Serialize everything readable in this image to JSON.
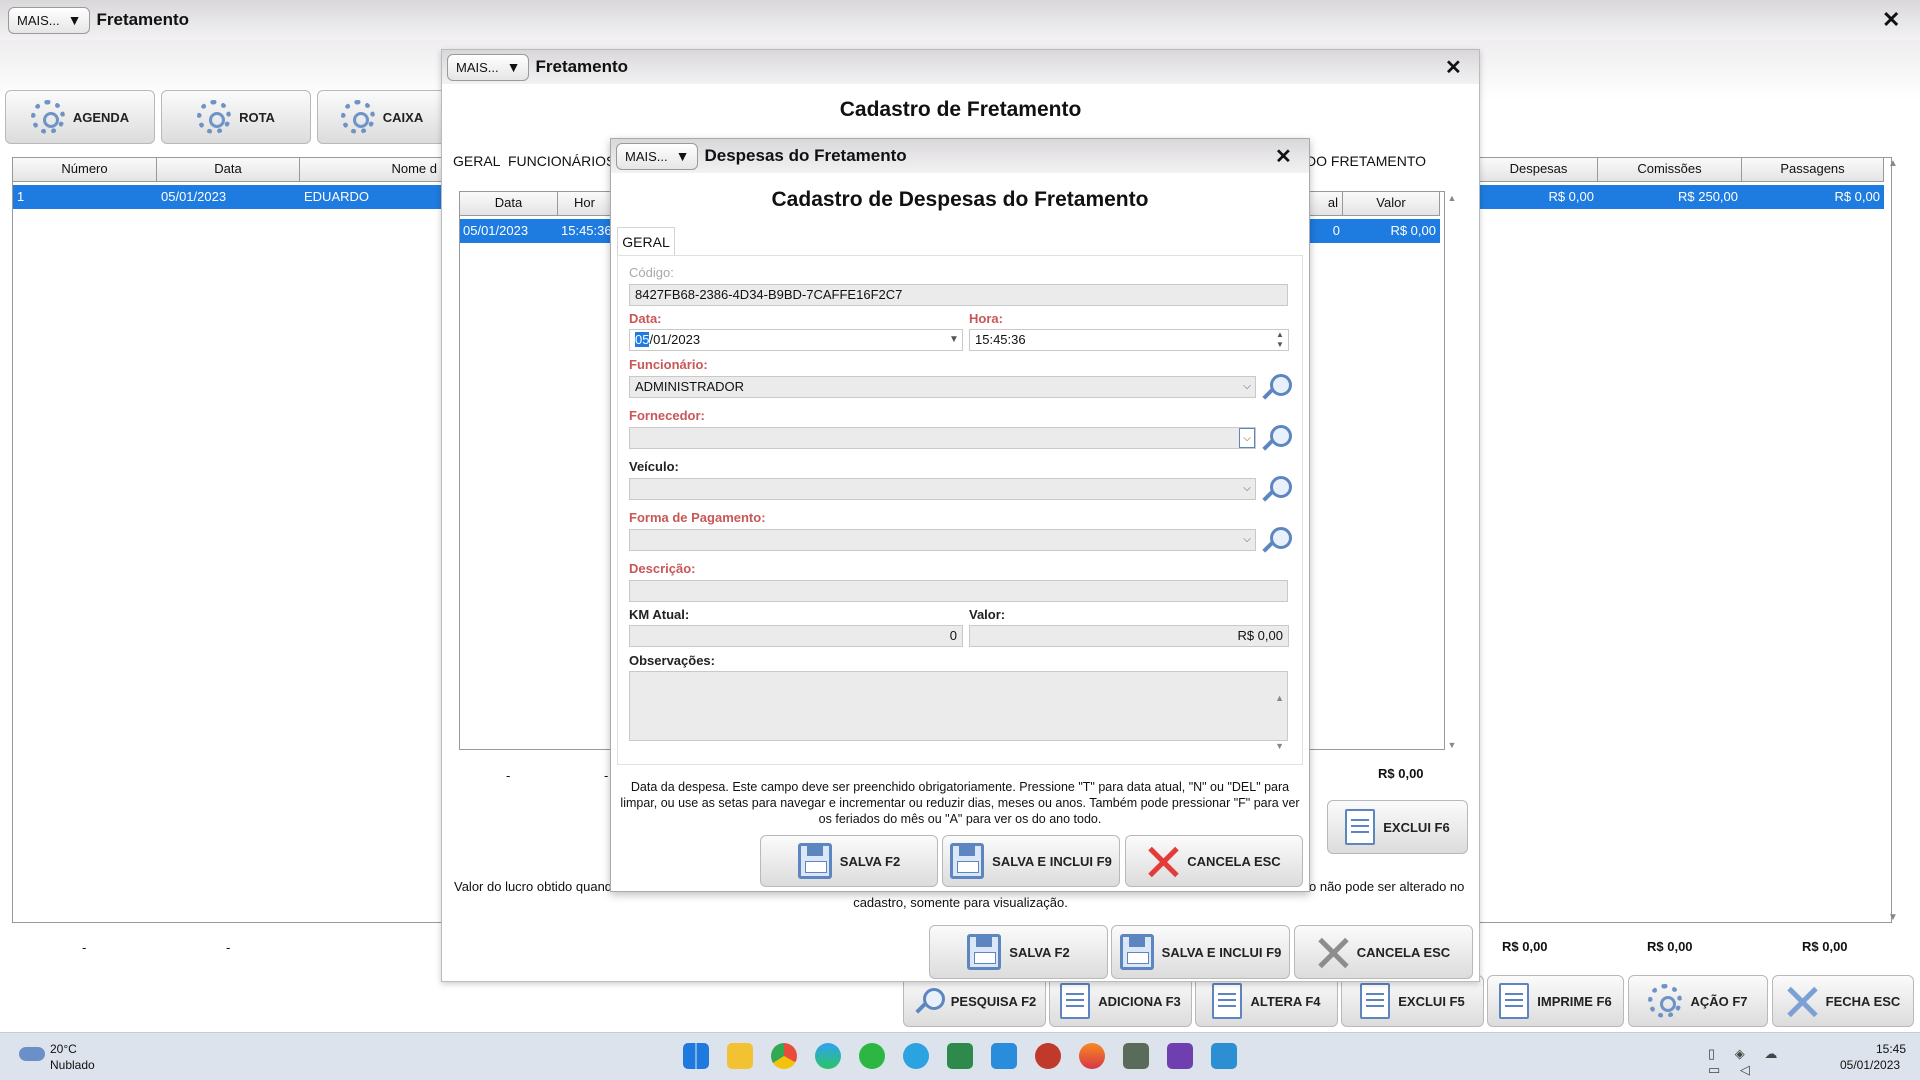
{
  "main_window": {
    "mais_label": "MAIS...",
    "title": "Fretamento",
    "toolbar": [
      {
        "label": "AGENDA"
      },
      {
        "label": "ROTA"
      },
      {
        "label": "CAIXA"
      }
    ],
    "grid_columns_left": [
      "Número",
      "Data",
      "Nome d"
    ],
    "grid_columns_right": [
      "Despesas",
      "Comissões",
      "Passagens"
    ],
    "row": {
      "numero": "1",
      "data": "05/01/2023",
      "nome": "EDUARDO",
      "despesas": "R$ 0,00",
      "comissoes": "R$ 250,00",
      "passagens": "R$ 0,00"
    },
    "footer_left": [
      "-",
      "-"
    ],
    "footer_totals": [
      "R$ 0,00",
      "R$ 0,00",
      "R$ 0,00"
    ],
    "bottom_buttons": [
      {
        "label": "PESQUISA F2"
      },
      {
        "label": "ADICIONA F3"
      },
      {
        "label": "ALTERA F4"
      },
      {
        "label": "EXCLUI F5"
      },
      {
        "label": "IMPRIME F6"
      },
      {
        "label": "AÇÃO F7"
      },
      {
        "label": "FECHA ESC"
      }
    ]
  },
  "cadastro_window": {
    "mais_label": "MAIS...",
    "title": "Fretamento",
    "heading": "Cadastro de Fretamento",
    "tabs": [
      "GERAL",
      "FUNCIONÁRIOS/",
      "DO FRETAMENTO"
    ],
    "grid_columns": [
      "Data",
      "Hor",
      "al",
      "Valor"
    ],
    "row": {
      "data": "05/01/2023",
      "hora": "15:45:36",
      "qtd": "0",
      "valor": "R$ 0,00"
    },
    "footer": [
      "-",
      "-",
      "R$ 0,00"
    ],
    "exclui_button": "EXCLUI F6",
    "help_text_1": "Valor do lucro obtido quand",
    "help_text_2": "o não pode ser alterado no",
    "help_text_3": "cadastro, somente para visualização.",
    "buttons": [
      {
        "label": "SALVA F2"
      },
      {
        "label": "SALVA E INCLUI F9"
      },
      {
        "label": "CANCELA ESC"
      }
    ]
  },
  "despesas_dialog": {
    "mais_label": "MAIS...",
    "title": "Despesas do Fretamento",
    "heading": "Cadastro de Despesas do Fretamento",
    "tab": "GERAL",
    "fields": {
      "codigo_label": "Código:",
      "codigo_value": "8427FB68-2386-4D34-B9BD-7CAFFE16F2C7",
      "data_label": "Data:",
      "data_value_selected": "05",
      "data_value_rest": "/01/2023",
      "hora_label": "Hora:",
      "hora_value": "15:45:36",
      "funcionario_label": "Funcionário:",
      "funcionario_value": "ADMINISTRADOR",
      "fornecedor_label": "Fornecedor:",
      "veiculo_label": "Veículo:",
      "pagamento_label": "Forma de Pagamento:",
      "descricao_label": "Descrição:",
      "km_label": "KM Atual:",
      "km_value": "0",
      "valor_label": "Valor:",
      "valor_value": "R$ 0,00",
      "obs_label": "Observações:"
    },
    "hint": "Data da despesa. Este campo deve ser preenchido obrigatoriamente. Pressione \"T\" para data atual, \"N\" ou \"DEL\" para limpar, ou use as setas para navegar e incrementar ou reduzir dias, meses ou anos. Também pode pressionar \"F\" para ver os feriados do mês ou \"A\" para ver os do ano todo.",
    "buttons": [
      {
        "label": "SALVA F2"
      },
      {
        "label": "SALVA E INCLUI F9"
      },
      {
        "label": "CANCELA ESC"
      }
    ]
  },
  "taskbar": {
    "weather_temp": "20°C",
    "weather_desc": "Nublado",
    "time": "15:45",
    "date": "05/01/2023"
  }
}
